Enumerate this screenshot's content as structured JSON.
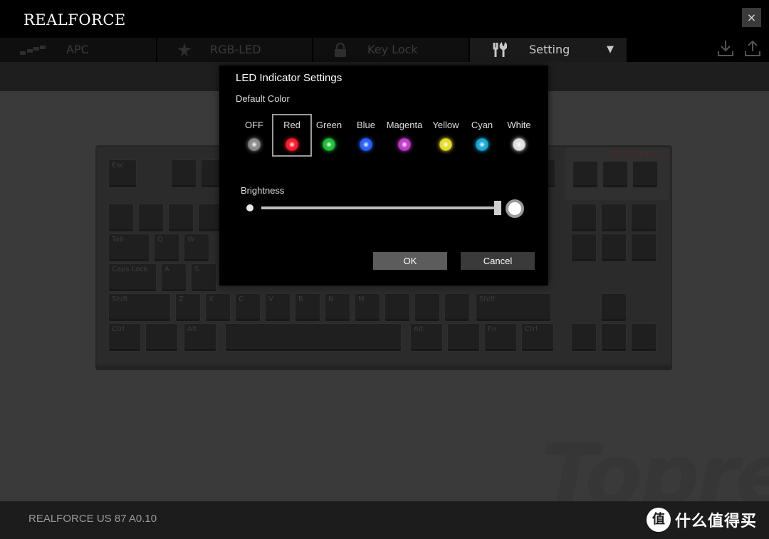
{
  "app": {
    "logo": "REALFORCE",
    "close_label": "×"
  },
  "tabs": [
    {
      "label": "APC",
      "icon": "bar-levels-icon"
    },
    {
      "label": "RGB-LED",
      "icon": "led-burst-icon"
    },
    {
      "label": "Key Lock",
      "icon": "lock-icon"
    },
    {
      "label": "Setting",
      "icon": "tools-icon",
      "active": true
    }
  ],
  "tab_dropdown_arrow": "▼",
  "toolbar_icons": [
    "download-icon",
    "upload-icon"
  ],
  "keyboard_preview": {
    "brand": "REALFORCE",
    "keys": {
      "esc": "Esc",
      "tab": "Tab",
      "caps": "Caps Lock",
      "shift_l": "Shift",
      "shift_r": "Shift",
      "ctrl_l": "Ctrl",
      "alt_l": "Alt",
      "alt_r": "Alt",
      "fn": "Fn",
      "ctrl_r": "Ctrl",
      "q": "Q",
      "w": "W",
      "a": "A",
      "s": "S",
      "z": "Z",
      "x": "X",
      "c": "C",
      "v": "V",
      "b": "B",
      "n": "N",
      "m": "M"
    }
  },
  "watermark": "Topre",
  "status": {
    "version": "REALFORCE US 87  A0.10"
  },
  "site_badge": {
    "logo_glyph": "值",
    "text": "什么值得买"
  },
  "dialog": {
    "title": "LED Indicator Settings",
    "subtitle": "Default Color",
    "colors": [
      {
        "name": "OFF",
        "hex": "#8a8a8a"
      },
      {
        "name": "Red",
        "hex": "#ff1a2e",
        "selected": true
      },
      {
        "name": "Green",
        "hex": "#1fbf3a"
      },
      {
        "name": "Blue",
        "hex": "#2a62ff"
      },
      {
        "name": "Magenta",
        "hex": "#c23bc9"
      },
      {
        "name": "Yellow",
        "hex": "#e6dc2a"
      },
      {
        "name": "Cyan",
        "hex": "#1ba9d6"
      },
      {
        "name": "White",
        "hex": "#e0e0e0"
      }
    ],
    "brightness_label": "Brightness",
    "brightness_level": 1.0,
    "ok_label": "OK",
    "cancel_label": "Cancel"
  }
}
